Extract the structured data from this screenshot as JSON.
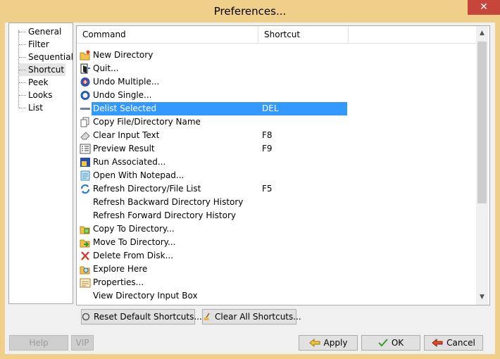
{
  "window": {
    "title": "Preferences...",
    "close_glyph": "✕"
  },
  "tree": {
    "items": [
      {
        "label": "General",
        "selected": false
      },
      {
        "label": "Filter",
        "selected": false
      },
      {
        "label": "Sequential",
        "selected": false
      },
      {
        "label": "Shortcut",
        "selected": true
      },
      {
        "label": "Peek",
        "selected": false
      },
      {
        "label": "Looks",
        "selected": false
      },
      {
        "label": "List",
        "selected": false
      }
    ]
  },
  "list": {
    "columns": [
      "Command",
      "Shortcut"
    ],
    "rows": [
      {
        "icon": "new-folder-icon",
        "command": "New Directory",
        "shortcut": ""
      },
      {
        "icon": "exit-door-icon",
        "command": "Quit...",
        "shortcut": ""
      },
      {
        "icon": "undo-multiple-icon",
        "command": "Undo Multiple...",
        "shortcut": ""
      },
      {
        "icon": "undo-single-icon",
        "command": "Undo Single...",
        "shortcut": ""
      },
      {
        "icon": "delist-icon",
        "command": "Delist Selected",
        "shortcut": "DEL",
        "selected": true
      },
      {
        "icon": "copy-name-icon",
        "command": "Copy File/Directory Name",
        "shortcut": ""
      },
      {
        "icon": "eraser-icon",
        "command": "Clear Input Text",
        "shortcut": "F8"
      },
      {
        "icon": "preview-list-icon",
        "command": "Preview Result",
        "shortcut": "F9"
      },
      {
        "icon": "run-icon",
        "command": "Run Associated...",
        "shortcut": ""
      },
      {
        "icon": "notepad-icon",
        "command": "Open With Notepad...",
        "shortcut": ""
      },
      {
        "icon": "refresh-icon",
        "command": "Refresh Directory/File List",
        "shortcut": "F5"
      },
      {
        "icon": "",
        "command": "Refresh Backward Directory History",
        "shortcut": ""
      },
      {
        "icon": "",
        "command": "Refresh Forward Directory History",
        "shortcut": ""
      },
      {
        "icon": "copy-to-folder-icon",
        "command": "Copy To Directory...",
        "shortcut": ""
      },
      {
        "icon": "move-to-folder-icon",
        "command": "Move To Directory...",
        "shortcut": ""
      },
      {
        "icon": "delete-x-icon",
        "command": "Delete From Disk...",
        "shortcut": ""
      },
      {
        "icon": "explore-icon",
        "command": "Explore Here",
        "shortcut": ""
      },
      {
        "icon": "properties-icon",
        "command": "Properties...",
        "shortcut": ""
      },
      {
        "icon": "",
        "command": "View Directory Input Box",
        "shortcut": ""
      }
    ]
  },
  "buttons": {
    "reset": "Reset Default Shortcuts...",
    "clear": "Clear All Shortcuts...",
    "help": "Help",
    "vip": "VIP",
    "apply": "Apply",
    "ok": "OK",
    "cancel": "Cancel"
  },
  "colors": {
    "title_bar": "#f0cf8a",
    "selection": "#3399ff",
    "close": "#c7463c"
  }
}
